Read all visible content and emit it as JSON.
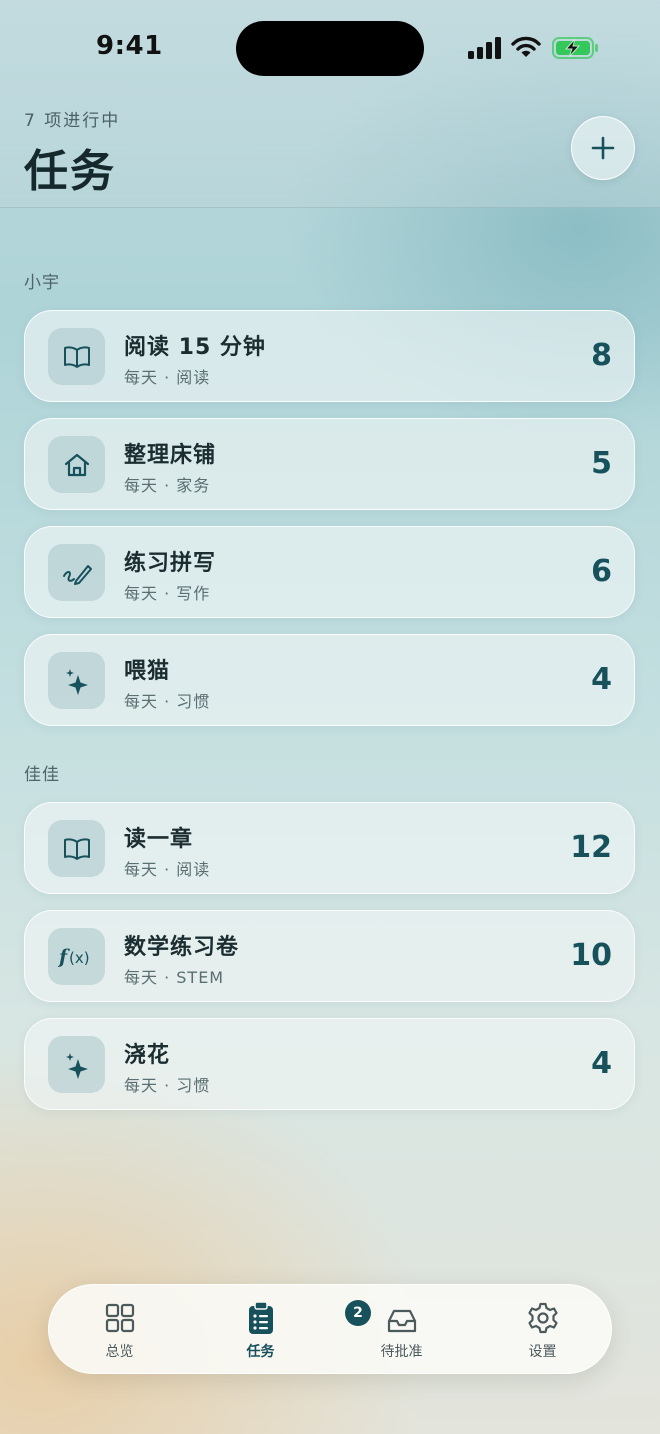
{
  "status_bar": {
    "time": "9:41"
  },
  "header": {
    "subtitle": "7 项进行中",
    "title": "任务"
  },
  "sections": [
    {
      "label": "小宇",
      "tasks": [
        {
          "title": "阅读 15 分钟",
          "subtitle": "每天 · 阅读",
          "points": "8",
          "icon": "book-icon"
        },
        {
          "title": "整理床铺",
          "subtitle": "每天 · 家务",
          "points": "5",
          "icon": "house-icon"
        },
        {
          "title": "练习拼写",
          "subtitle": "每天 · 写作",
          "points": "6",
          "icon": "pencil-icon"
        },
        {
          "title": "喂猫",
          "subtitle": "每天 · 习惯",
          "points": "4",
          "icon": "sparkles-icon"
        }
      ]
    },
    {
      "label": "佳佳",
      "tasks": [
        {
          "title": "读一章",
          "subtitle": "每天 · 阅读",
          "points": "12",
          "icon": "book-icon"
        },
        {
          "title": "数学练习卷",
          "subtitle": "每天 · STEM",
          "points": "10",
          "icon": "function-icon"
        },
        {
          "title": "浇花",
          "subtitle": "每天 · 习惯",
          "points": "4",
          "icon": "sparkles-icon"
        }
      ]
    }
  ],
  "tabbar": {
    "tabs": [
      {
        "label": "总览",
        "icon": "grid-icon",
        "active": false
      },
      {
        "label": "任务",
        "icon": "clipboard-list-icon",
        "active": true
      },
      {
        "label": "待批准",
        "icon": "inbox-icon",
        "active": false,
        "badge": "2"
      },
      {
        "label": "设置",
        "icon": "gear-icon",
        "active": false
      }
    ]
  },
  "colors": {
    "accent": "#17515c",
    "battery_green": "#34c759"
  }
}
